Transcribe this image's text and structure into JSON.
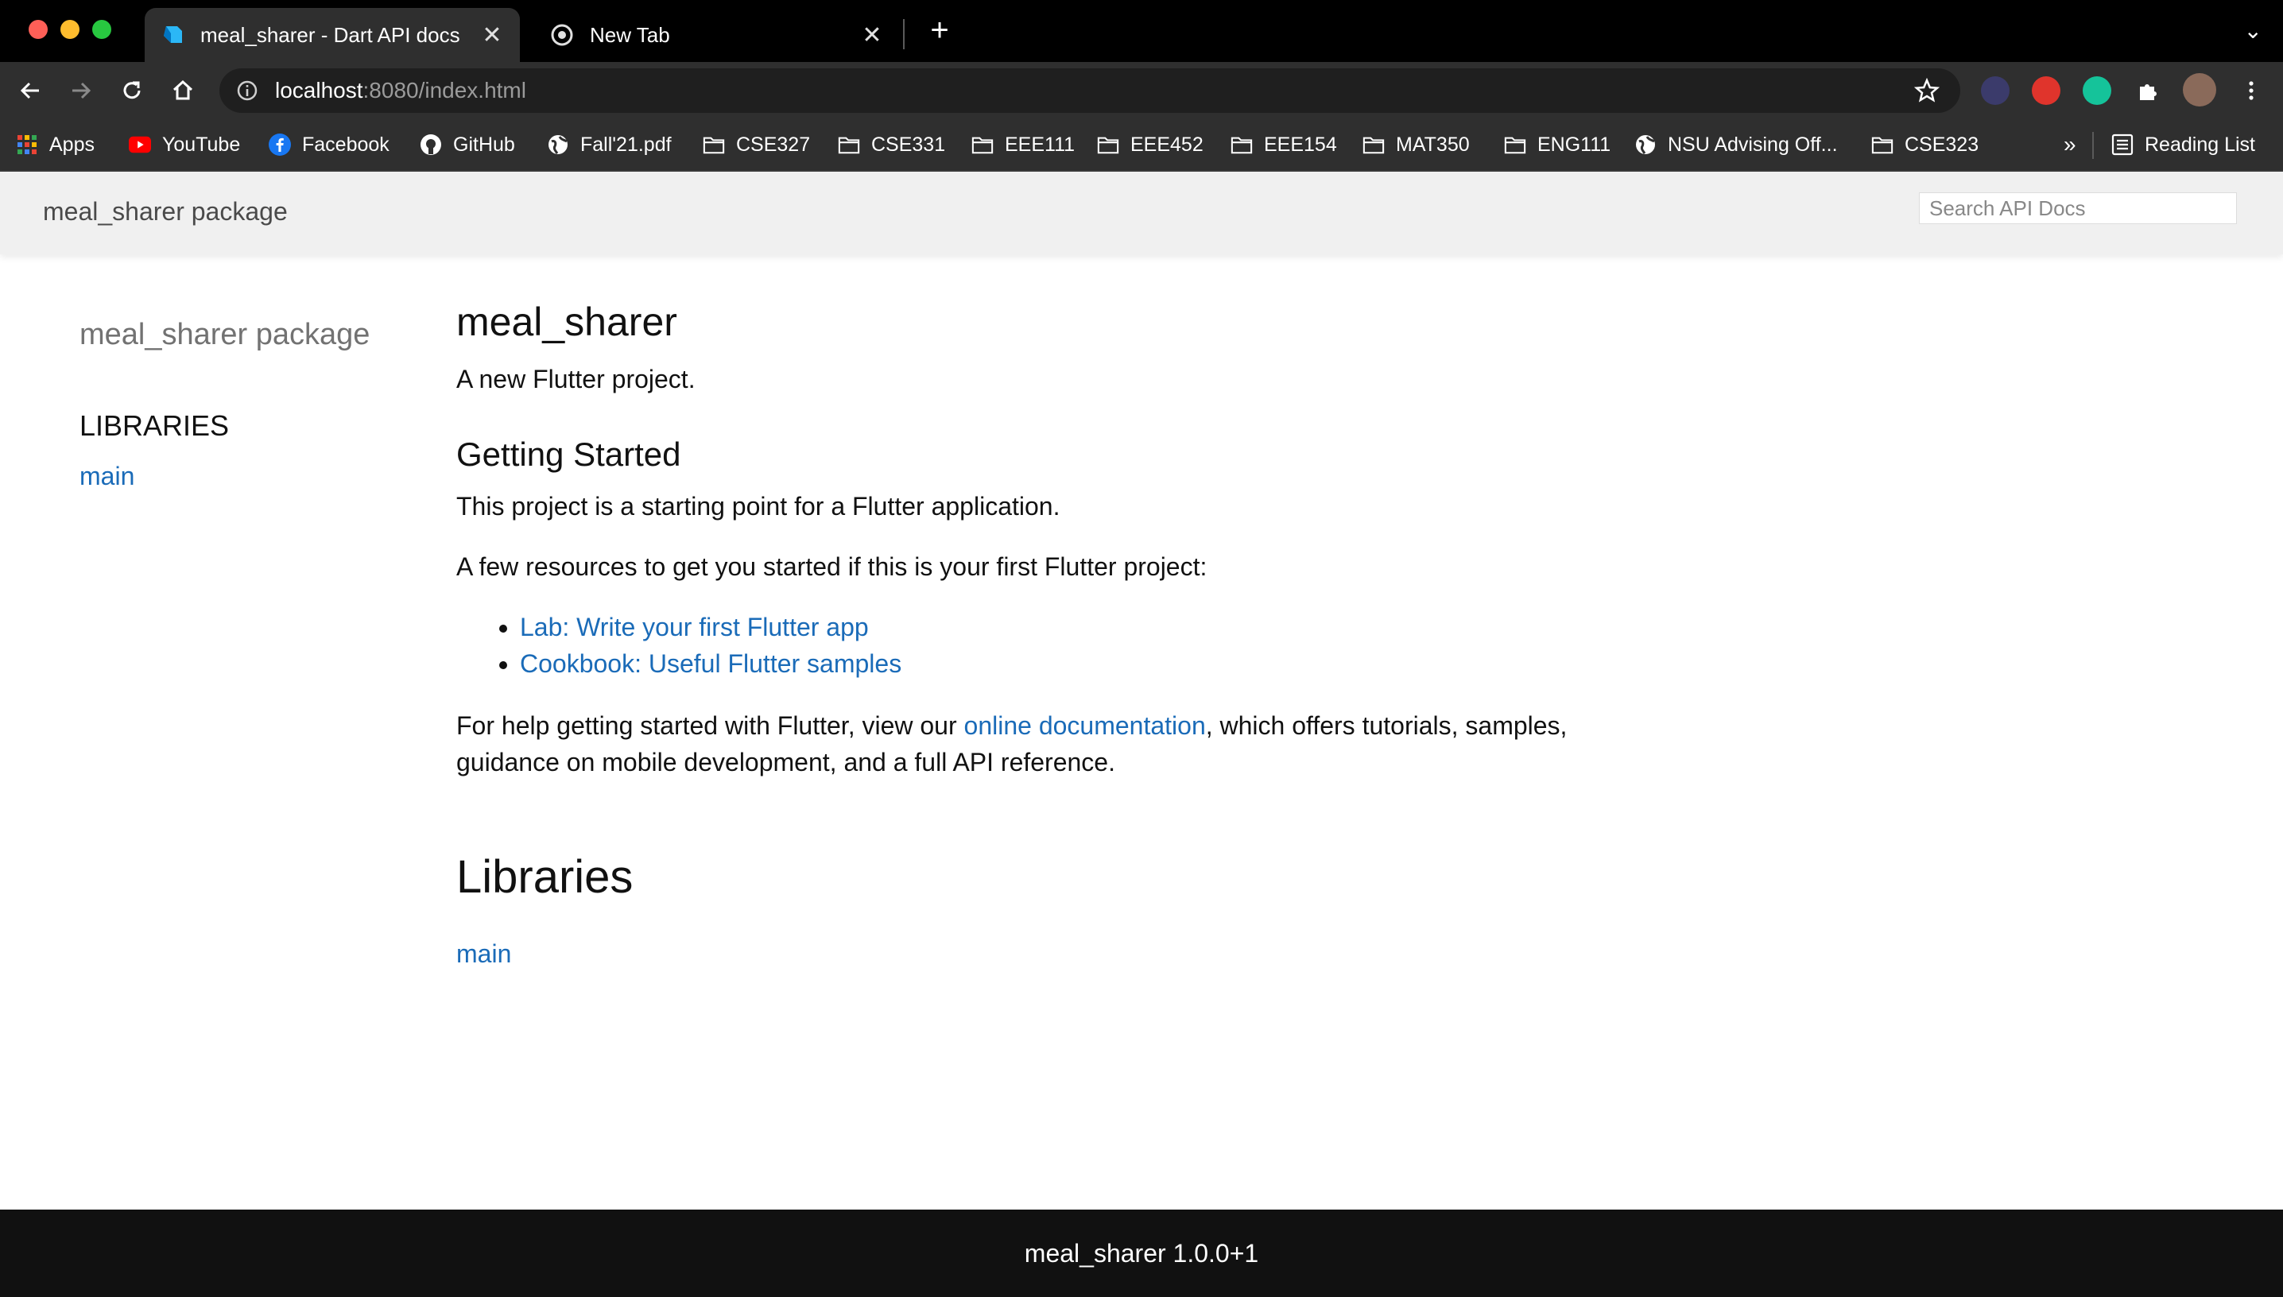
{
  "browser": {
    "tabs": [
      {
        "title": "meal_sharer - Dart API docs",
        "active": true
      },
      {
        "title": "New Tab",
        "active": false
      }
    ],
    "url_host": "localhost",
    "url_rest": ":8080/index.html",
    "bookmarks": [
      {
        "label": "Apps",
        "icon": "apps-grid-icon"
      },
      {
        "label": "YouTube",
        "icon": "youtube-icon"
      },
      {
        "label": "Facebook",
        "icon": "facebook-icon"
      },
      {
        "label": "GitHub",
        "icon": "github-icon"
      },
      {
        "label": "Fall'21.pdf",
        "icon": "globe-icon"
      },
      {
        "label": "CSE327",
        "icon": "folder-icon"
      },
      {
        "label": "CSE331",
        "icon": "folder-icon"
      },
      {
        "label": "EEE111",
        "icon": "folder-icon"
      },
      {
        "label": "EEE452",
        "icon": "folder-icon"
      },
      {
        "label": "EEE154",
        "icon": "folder-icon"
      },
      {
        "label": "MAT350",
        "icon": "folder-icon"
      },
      {
        "label": "ENG111",
        "icon": "folder-icon"
      },
      {
        "label": "NSU Advising Off...",
        "icon": "globe-icon"
      },
      {
        "label": "CSE323",
        "icon": "folder-icon"
      }
    ],
    "overflow_label": "»",
    "reading_list_label": "Reading List"
  },
  "header": {
    "package_title": "meal_sharer package",
    "search_placeholder": "Search API Docs"
  },
  "sidebar": {
    "package_name": "meal_sharer package",
    "libraries_heading": "LIBRARIES",
    "library_link": "main"
  },
  "main": {
    "title": "meal_sharer",
    "description": "A new Flutter project.",
    "getting_started_heading": "Getting Started",
    "starting_point_text": "This project is a starting point for a Flutter application.",
    "resources_intro": "A few resources to get you started if this is your first Flutter project:",
    "resources": [
      "Lab: Write your first Flutter app",
      "Cookbook: Useful Flutter samples"
    ],
    "help_text_before": "For help getting started with Flutter, view our ",
    "help_link": "online documentation",
    "help_text_after": ", which offers tutorials, samples, guidance on mobile development, and a full API reference.",
    "libraries_title": "Libraries",
    "library_link": "main"
  },
  "footer": {
    "text": "meal_sharer 1.0.0+1"
  },
  "colors": {
    "link": "#1a6bb8",
    "header_bg": "#f0f0f0",
    "footer_bg": "#111111"
  }
}
